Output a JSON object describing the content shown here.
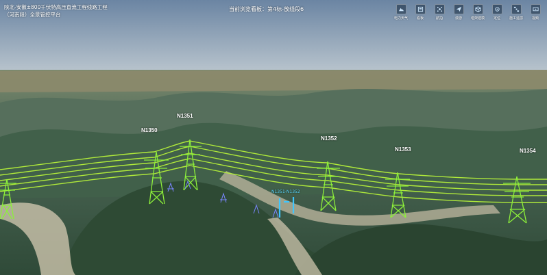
{
  "header": {
    "title": "陕北-安徽±800千伏特高压直流工程线路工程（河南段）全景管控平台",
    "current_view": "当前浏览看板：第4标-放线段6"
  },
  "toolbar": [
    {
      "label": "电力天气",
      "icon": "mountain-icon"
    },
    {
      "label": "看板",
      "icon": "board-icon"
    },
    {
      "label": "航拍",
      "icon": "drone-icon"
    },
    {
      "label": "漫游",
      "icon": "navigate-icon"
    },
    {
      "label": "塔架建模",
      "icon": "cube-icon"
    },
    {
      "label": "定位",
      "icon": "locate-icon"
    },
    {
      "label": "施工遥感",
      "icon": "satellite-icon"
    },
    {
      "label": "视频",
      "icon": "video-icon"
    }
  ],
  "towers": [
    {
      "label": "N1350"
    },
    {
      "label": "N1351"
    },
    {
      "label": "N1352"
    },
    {
      "label": "N1353"
    },
    {
      "label": "N1354"
    }
  ],
  "site_label": "N1351-N1352",
  "colors": {
    "conductor": "#b6f23a",
    "tower": "#8df03a",
    "sky_top": "#6b85a3",
    "sky_bottom": "#b9c5cf"
  }
}
